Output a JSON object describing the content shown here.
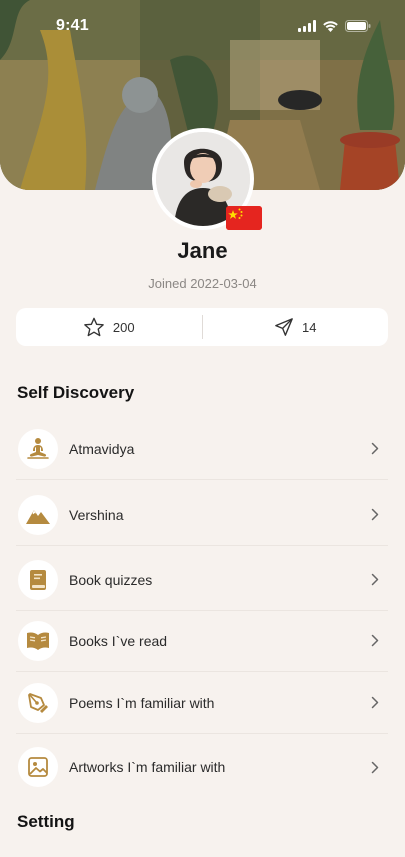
{
  "status": {
    "time": "9:41"
  },
  "profile": {
    "name": "Jane",
    "joined": "Joined 2022-03-04"
  },
  "stats": {
    "favorites_count": "200",
    "shares_count": "14"
  },
  "sections": {
    "self_discovery": "Self Discovery",
    "setting": "Setting"
  },
  "menu": [
    {
      "label": "Atmavidya",
      "icon": "meditation-icon"
    },
    {
      "label": "Vershina",
      "icon": "mountain-icon"
    },
    {
      "label": "Book quizzes",
      "icon": "book-icon"
    },
    {
      "label": "Books I`ve read",
      "icon": "open-book-icon"
    },
    {
      "label": "Poems I`m familiar with",
      "icon": "pen-nib-icon"
    },
    {
      "label": "Artworks I`m familiar with",
      "icon": "image-icon"
    }
  ],
  "colors": {
    "accent": "#b58a3f",
    "background": "#f7f2ee",
    "flag": "#e5251f"
  }
}
